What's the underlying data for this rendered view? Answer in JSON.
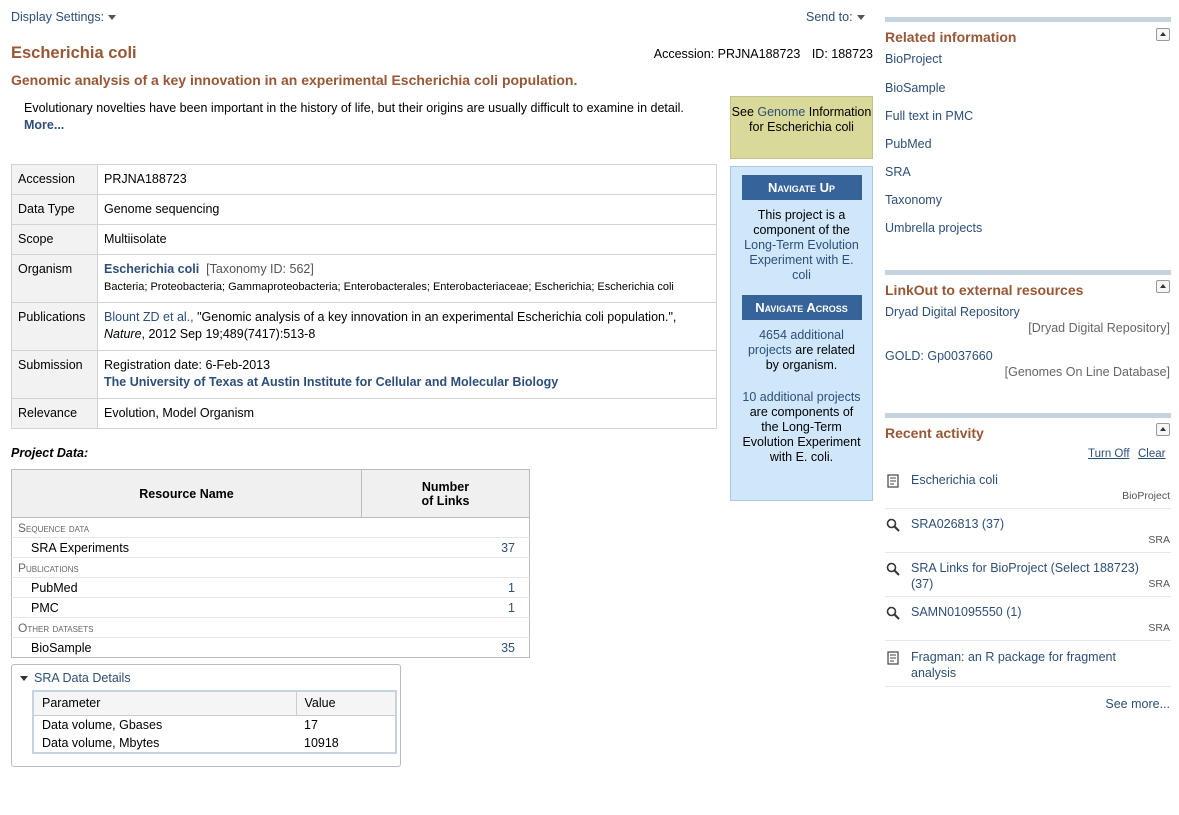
{
  "top": {
    "display_settings": "Display Settings:",
    "send_to": "Send to:"
  },
  "header": {
    "organism_title": "Escherichia coli",
    "accession_label": "Accession: PRJNA188723",
    "id_label": "ID: 188723",
    "project_title": "Genomic analysis of a key innovation in an experimental Escherichia coli population."
  },
  "description": {
    "text": "Evolutionary novelties have been important in the history of life, but their origins are usually difficult to examine in detail.",
    "more": "More..."
  },
  "summary": {
    "accession": {
      "label": "Accession",
      "value": "PRJNA188723"
    },
    "data_type": {
      "label": "Data Type",
      "value": "Genome sequencing"
    },
    "scope": {
      "label": "Scope",
      "value": "Multiisolate"
    },
    "organism": {
      "label": "Organism",
      "name": "Escherichia coli",
      "taxonomy": "[Taxonomy ID: 562]",
      "lineage": "Bacteria; Proteobacteria; Gammaproteobacteria; Enterobacterales; Enterobacteriaceae; Escherichia; Escherichia coli"
    },
    "publications": {
      "label": "Publications",
      "authors": "Blount ZD et al.,",
      "title": " \"Genomic analysis of a key innovation in an experimental Escherichia coli population.\",",
      "journal": "Nature",
      "citation": ", 2012 Sep 19;489(7417):513-8"
    },
    "submission": {
      "label": "Submission",
      "registration": "Registration date: 6-Feb-2013",
      "institution": "The University of Texas at Austin Institute for Cellular and Molecular Biology"
    },
    "relevance": {
      "label": "Relevance",
      "value": "Evolution, Model Organism"
    }
  },
  "project_data": {
    "label": "Project Data:",
    "col_resource": "Resource Name",
    "col_links_1": "Number",
    "col_links_2": "of Links",
    "groups": [
      {
        "name": "Sequence data",
        "rows": [
          {
            "name": "SRA Experiments",
            "count": "37"
          }
        ]
      },
      {
        "name": "Publications",
        "rows": [
          {
            "name": "PubMed",
            "count": "1"
          },
          {
            "name": "PMC",
            "count": "1"
          }
        ]
      },
      {
        "name": "Other datasets",
        "rows": [
          {
            "name": "BioSample",
            "count": "35"
          }
        ]
      }
    ]
  },
  "sra_details": {
    "title": "SRA Data Details",
    "col_param": "Parameter",
    "col_value": "Value",
    "rows": [
      {
        "param": "Data volume, Gbases",
        "value": "17"
      },
      {
        "param": "Data volume, Mbytes",
        "value": "10918"
      }
    ]
  },
  "genome_box": {
    "prefix": "See ",
    "link": "Genome",
    "suffix": " Information for Escherichia coli"
  },
  "navigate": {
    "up_title": "Navigate Up",
    "up_text_1": "This project is a component of the ",
    "up_link": "Long-Term Evolution Experiment with E. coli",
    "across_title": "Navigate Across",
    "across_link_1": "4654 additional projects",
    "across_text_1": " are related by organism.",
    "across_link_2": "10 additional projects",
    "across_text_2": " are components of the Long-Term Evolution Experiment with E. coli."
  },
  "related": {
    "title": "Related information",
    "links": [
      "BioProject",
      "BioSample",
      "Full text in PMC",
      "PubMed",
      "SRA",
      "Taxonomy",
      "Umbrella projects"
    ]
  },
  "linkout": {
    "title": "LinkOut to external resources",
    "items": [
      {
        "name": "Dryad Digital Repository",
        "source": "[Dryad Digital Repository]"
      },
      {
        "name": "GOLD: Gp0037660",
        "source": "[Genomes On Line Database]"
      }
    ]
  },
  "recent": {
    "title": "Recent activity",
    "turn_off": "Turn Off",
    "clear": "Clear",
    "items": [
      {
        "icon": "document-icon",
        "text": "Escherichia coli",
        "db": "BioProject"
      },
      {
        "icon": "search-icon",
        "text": "SRA026813 (37)",
        "db": "SRA"
      },
      {
        "icon": "search-icon",
        "text": "SRA Links for BioProject (Select 188723) (37)",
        "db": "SRA"
      },
      {
        "icon": "search-icon",
        "text": "SAMN01095550 (1)",
        "db": "SRA"
      },
      {
        "icon": "document-icon",
        "text": "Fragman: an R package for fragment analysis",
        "db": ""
      }
    ],
    "see_more": "See more..."
  }
}
